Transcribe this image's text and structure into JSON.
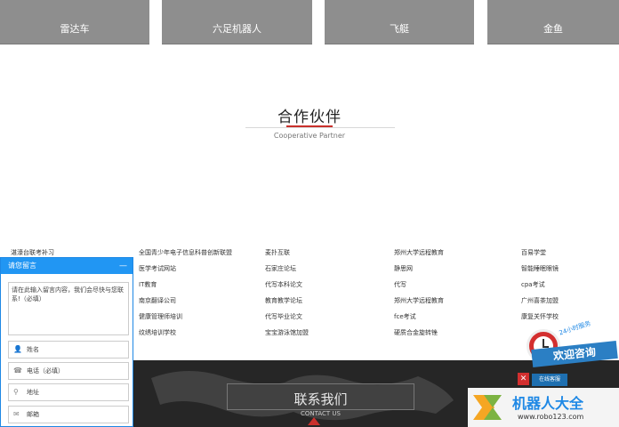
{
  "products": [
    "雷达车",
    "六足机器人",
    "飞艇",
    "金鱼"
  ],
  "partner": {
    "title": "合作伙伴",
    "subtitle": "Cooperative Partner"
  },
  "links": [
    [
      "湛濠台联考补习",
      "全国青少年电子信息科普创新联盟",
      "麦扑互联",
      "郑州大学远程教育",
      "百易学堂"
    ],
    [
      "",
      "医学考试网站",
      "石家庄论坛",
      "静思网",
      "智能睡眠眼镜"
    ],
    [
      "",
      "IT教育",
      "代写本科论文",
      "代写",
      "cpa考试"
    ],
    [
      "",
      "南京翻译公司",
      "教育教学论坛",
      "郑州大学远程教育",
      "广州喜茶加盟"
    ],
    [
      "",
      "健康管理师培训",
      "代写毕业论文",
      "fce考试",
      "康复关怀学校"
    ],
    [
      "",
      "纹绣培训学校",
      "宝宝游泳馆加盟",
      "硬质合金旋转锉",
      ""
    ]
  ],
  "contact": {
    "title": "联系我们",
    "subtitle": "CONTACT US"
  },
  "widget": {
    "header": "请您留言",
    "minimize": "—",
    "message_placeholder": "请在此输入留言内容，我们会尽快与您联系!（必填）",
    "fields": [
      {
        "icon": "user-icon",
        "label": "姓名"
      },
      {
        "icon": "phone-icon",
        "label": "电话（必填）"
      },
      {
        "icon": "location-icon",
        "label": "地址"
      },
      {
        "icon": "mail-icon",
        "label": "邮箱"
      }
    ]
  },
  "consult": {
    "badge_24": "24小时服务",
    "tag": "欢迎咨询",
    "online": "在线客服",
    "close": "✕"
  },
  "watermark": {
    "title": "机器人大全",
    "url": "www.robo123.com"
  },
  "colors": {
    "accent_blue": "#2196f3",
    "accent_red": "#c9302c",
    "card_gray": "#8e8e8e",
    "band_dark": "#262626"
  }
}
